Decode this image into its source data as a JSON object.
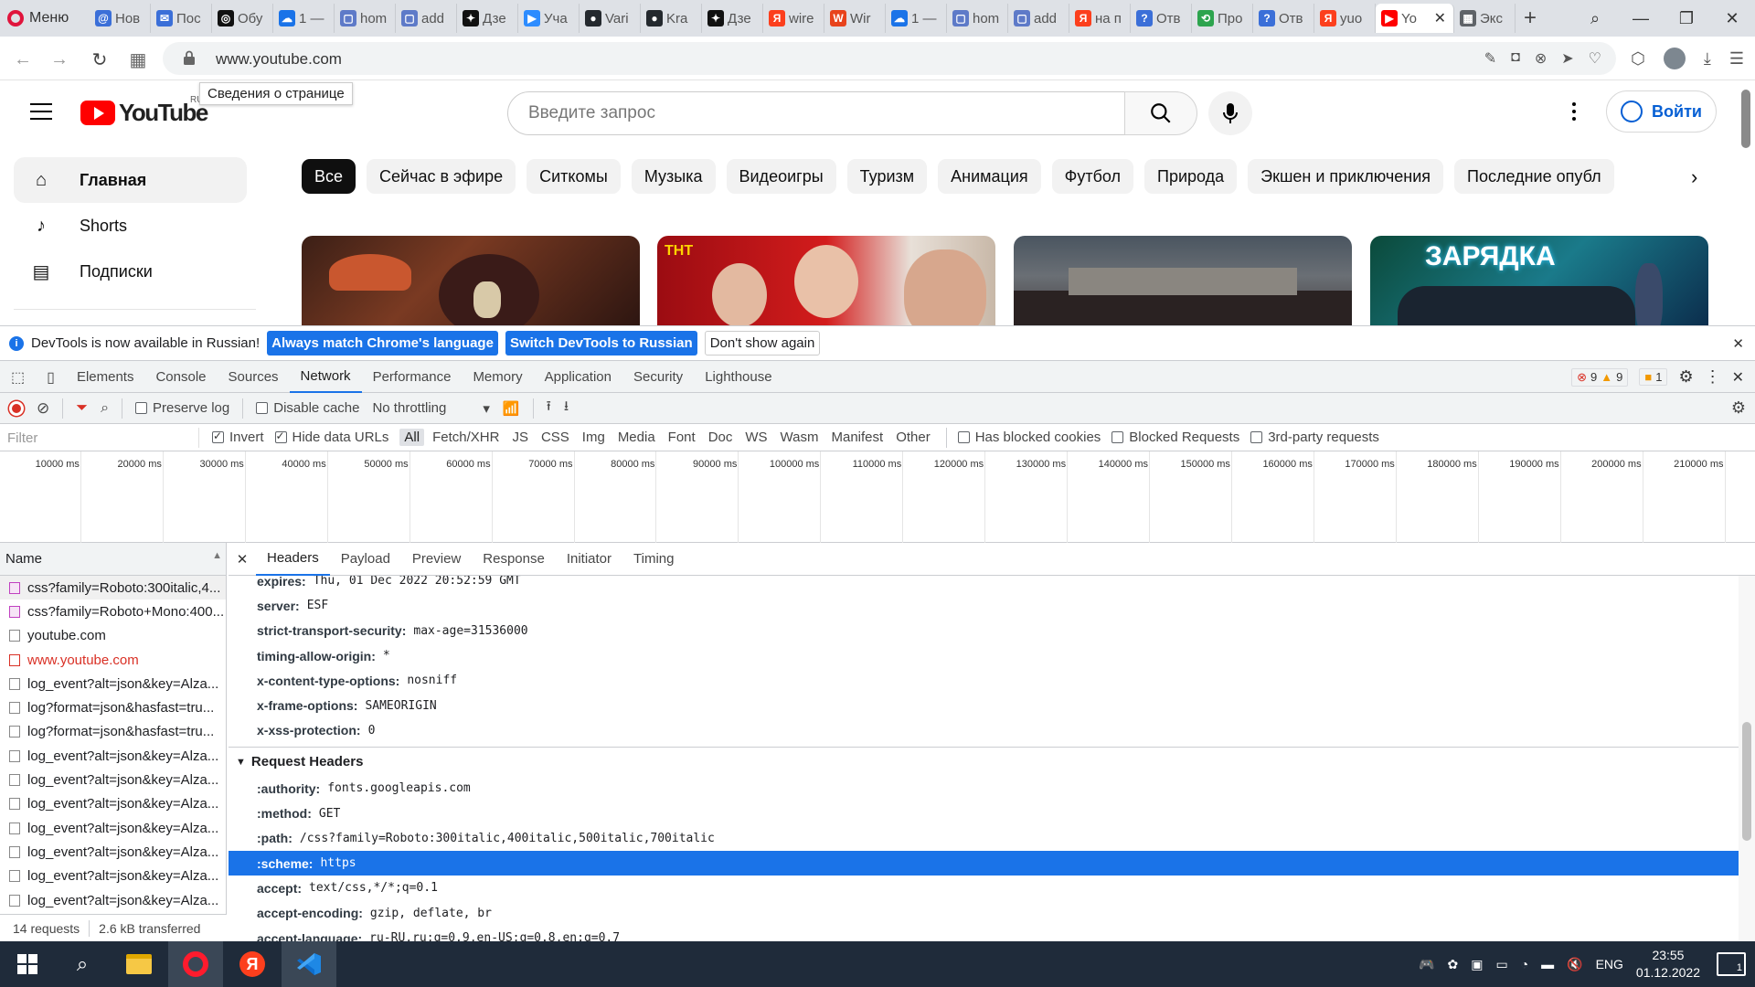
{
  "browser": {
    "menu_label": "Меню",
    "tabs": [
      {
        "label": "Нов",
        "color": "#3b6fd8",
        "glyph": "@"
      },
      {
        "label": "Пос",
        "color": "#3b6fd8",
        "glyph": "✉"
      },
      {
        "label": "Обу",
        "color": "#111111",
        "glyph": "◎"
      },
      {
        "label": "1 —",
        "color": "#1a73e8",
        "glyph": "☁"
      },
      {
        "label": "hom",
        "color": "#5e7ac8",
        "glyph": "▢"
      },
      {
        "label": "add",
        "color": "#5e7ac8",
        "glyph": "▢"
      },
      {
        "label": "Дзе",
        "color": "#111111",
        "glyph": "✦"
      },
      {
        "label": "Уча",
        "color": "#2d8cff",
        "glyph": "▶"
      },
      {
        "label": "Vari",
        "color": "#24292e",
        "glyph": "●"
      },
      {
        "label": "Kra",
        "color": "#24292e",
        "glyph": "●"
      },
      {
        "label": "Дзе",
        "color": "#111111",
        "glyph": "✦"
      },
      {
        "label": "wire",
        "color": "#fc3f1d",
        "glyph": "Я"
      },
      {
        "label": "Wir",
        "color": "#e8431c",
        "glyph": "W"
      },
      {
        "label": "1 —",
        "color": "#1a73e8",
        "glyph": "☁"
      },
      {
        "label": "hom",
        "color": "#5e7ac8",
        "glyph": "▢"
      },
      {
        "label": "add",
        "color": "#5e7ac8",
        "glyph": "▢"
      },
      {
        "label": "на п",
        "color": "#fc3f1d",
        "glyph": "Я"
      },
      {
        "label": "Отв",
        "color": "#3b6fd8",
        "glyph": "?"
      },
      {
        "label": "Про",
        "color": "#2da44e",
        "glyph": "⟲"
      },
      {
        "label": "Отв",
        "color": "#3b6fd8",
        "glyph": "?"
      },
      {
        "label": "yuo",
        "color": "#fc3f1d",
        "glyph": "Я"
      }
    ],
    "active_tab_label": "Yo",
    "extra_tab_label": "Экс",
    "url": "www.youtube.com",
    "tooltip": "Сведения о странице"
  },
  "youtube": {
    "logo_text": "YouTube",
    "logo_country": "RU",
    "search_placeholder": "Введите запрос",
    "signin_label": "Войти",
    "sidebar": [
      {
        "label": "Главная",
        "icon": "home-icon",
        "active": true
      },
      {
        "label": "Shorts",
        "icon": "shorts-icon",
        "active": false
      },
      {
        "label": "Подписки",
        "icon": "subscriptions-icon",
        "active": false
      }
    ],
    "chips": [
      "Все",
      "Сейчас в эфире",
      "Ситкомы",
      "Музыка",
      "Видеоигры",
      "Туризм",
      "Анимация",
      "Футбол",
      "Природа",
      "Экшен и приключения",
      "Последние опубл"
    ],
    "thumb_texts": [
      "",
      "ТНТ",
      "",
      "ЗАРЯДКА"
    ]
  },
  "devtools": {
    "info_text": "DevTools is now available in Russian!",
    "btn_match": "Always match Chrome's language",
    "btn_switch": "Switch DevTools to Russian",
    "btn_dont": "Don't show again",
    "tabs": [
      "Elements",
      "Console",
      "Sources",
      "Network",
      "Performance",
      "Memory",
      "Application",
      "Security",
      "Lighthouse"
    ],
    "active_tab": "Network",
    "errors": "9",
    "warnings": "9",
    "issues": "1",
    "toolbar": {
      "preserve_log": "Preserve log",
      "disable_cache": "Disable cache",
      "throttling": "No throttling"
    },
    "filter": {
      "placeholder": "Filter",
      "invert": "Invert",
      "hide_data_urls": "Hide data URLs",
      "types": [
        "All",
        "Fetch/XHR",
        "JS",
        "CSS",
        "Img",
        "Media",
        "Font",
        "Doc",
        "WS",
        "Wasm",
        "Manifest",
        "Other"
      ],
      "has_blocked_cookies": "Has blocked cookies",
      "blocked_requests": "Blocked Requests",
      "third_party": "3rd-party requests"
    },
    "timeline_ticks": [
      "10000 ms",
      "20000 ms",
      "30000 ms",
      "40000 ms",
      "50000 ms",
      "60000 ms",
      "70000 ms",
      "80000 ms",
      "90000 ms",
      "100000 ms",
      "110000 ms",
      "120000 ms",
      "130000 ms",
      "140000 ms",
      "150000 ms",
      "160000 ms",
      "170000 ms",
      "180000 ms",
      "190000 ms",
      "200000 ms",
      "210000 ms"
    ],
    "name_header": "Name",
    "requests": [
      {
        "name": "css?family=Roboto:300italic,4...",
        "type": "css",
        "selected": true
      },
      {
        "name": "css?family=Roboto+Mono:400...",
        "type": "css",
        "selected": false
      },
      {
        "name": "youtube.com",
        "type": "doc",
        "selected": false
      },
      {
        "name": "www.youtube.com",
        "type": "red",
        "selected": false
      },
      {
        "name": "log_event?alt=json&key=Alza...",
        "type": "doc",
        "selected": false
      },
      {
        "name": "log?format=json&hasfast=tru...",
        "type": "doc",
        "selected": false
      },
      {
        "name": "log?format=json&hasfast=tru...",
        "type": "doc",
        "selected": false
      },
      {
        "name": "log_event?alt=json&key=Alza...",
        "type": "doc",
        "selected": false
      },
      {
        "name": "log_event?alt=json&key=Alza...",
        "type": "doc",
        "selected": false
      },
      {
        "name": "log_event?alt=json&key=Alza...",
        "type": "doc",
        "selected": false
      },
      {
        "name": "log_event?alt=json&key=Alza...",
        "type": "doc",
        "selected": false
      },
      {
        "name": "log_event?alt=json&key=Alza...",
        "type": "doc",
        "selected": false
      },
      {
        "name": "log_event?alt=json&key=Alza...",
        "type": "doc",
        "selected": false
      },
      {
        "name": "log_event?alt=json&key=Alza...",
        "type": "doc",
        "selected": false
      }
    ],
    "summary_requests": "14 requests",
    "summary_transferred": "2.6 kB transferred",
    "detail_tabs": [
      "Headers",
      "Payload",
      "Preview",
      "Response",
      "Initiator",
      "Timing"
    ],
    "active_detail_tab": "Headers",
    "response_headers": [
      {
        "k": "expires:",
        "v": "Thu, 01 Dec 2022 20:52:59 GMT"
      },
      {
        "k": "server:",
        "v": "ESF"
      },
      {
        "k": "strict-transport-security:",
        "v": "max-age=31536000"
      },
      {
        "k": "timing-allow-origin:",
        "v": "*"
      },
      {
        "k": "x-content-type-options:",
        "v": "nosniff"
      },
      {
        "k": "x-frame-options:",
        "v": "SAMEORIGIN"
      },
      {
        "k": "x-xss-protection:",
        "v": "0"
      }
    ],
    "request_section": "Request Headers",
    "request_headers": [
      {
        "k": ":authority:",
        "v": "fonts.googleapis.com",
        "selected": false
      },
      {
        "k": ":method:",
        "v": "GET",
        "selected": false
      },
      {
        "k": ":path:",
        "v": "/css?family=Roboto:300italic,400italic,500italic,700italic",
        "selected": false
      },
      {
        "k": ":scheme:",
        "v": "https",
        "selected": true
      },
      {
        "k": "accept:",
        "v": "text/css,*/*;q=0.1",
        "selected": false
      },
      {
        "k": "accept-encoding:",
        "v": "gzip, deflate, br",
        "selected": false
      },
      {
        "k": "accept-language:",
        "v": "ru-RU,ru;q=0.9,en-US;q=0.8,en;q=0.7",
        "selected": false
      }
    ]
  },
  "taskbar": {
    "lang": "ENG",
    "time": "23:55",
    "date": "01.12.2022",
    "notifications": "1"
  }
}
